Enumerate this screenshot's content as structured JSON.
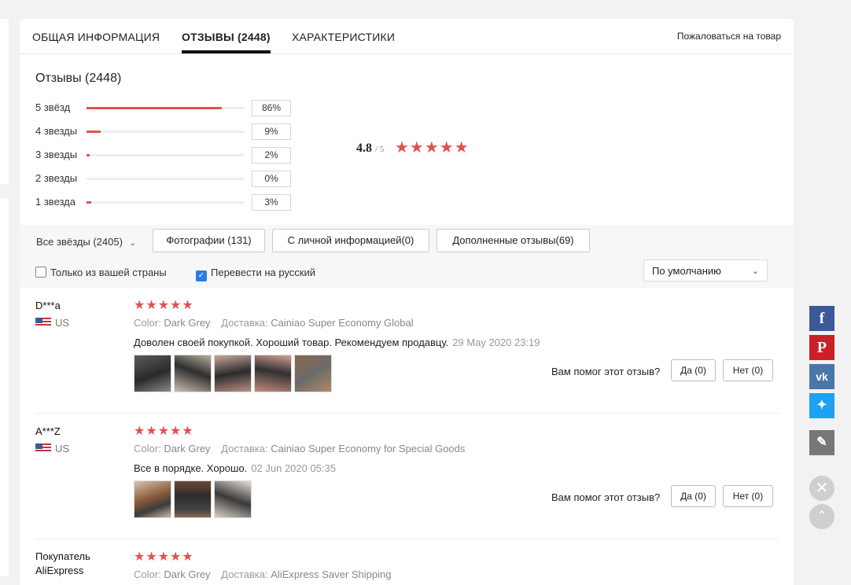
{
  "tabs": {
    "general": "ОБЩАЯ ИНФОРМАЦИЯ",
    "reviews": "ОТЗЫВЫ (2448)",
    "specs": "ХАРАКТЕРИСТИКИ",
    "report": "Пожаловаться на товар"
  },
  "summary": {
    "title": "Отзывы (2448)",
    "rows": [
      {
        "label": "5 звёзд",
        "percent": "86%",
        "fraction": 0.86
      },
      {
        "label": "4 звезды",
        "percent": "9%",
        "fraction": 0.09
      },
      {
        "label": "3 звезды",
        "percent": "2%",
        "fraction": 0.02
      },
      {
        "label": "2 звезды",
        "percent": "0%",
        "fraction": 0.0
      },
      {
        "label": "1 звезда",
        "percent": "3%",
        "fraction": 0.03
      }
    ],
    "average": "4.8",
    "max": "/ 5",
    "stars": "★★★★★"
  },
  "filters": {
    "all_stars": "Все звёзды (2405)",
    "photos": "Фотографии (131)",
    "personal_info": "С личной информацией(0)",
    "additional": "Дополненные отзывы(69)",
    "only_country": "Только из вашей страны",
    "translate": "Перевести на русский",
    "sort": "По умолчанию"
  },
  "reviews": [
    {
      "name": "D***a",
      "country": "US",
      "stars": "★★★★★",
      "color_label": "Color:",
      "color": "Dark Grey",
      "shipping_label": "Доставка:",
      "shipping": "Cainiao Super Economy Global",
      "text": "Доволен своей покупкой. Хороший товар. Рекомендуем продавцу.",
      "date": "29 May 2020 23:19",
      "photo_count": 5,
      "helpful": "Вам помог этот отзыв?",
      "yes": "Да (0)",
      "no": "Нет (0)"
    },
    {
      "name": "A***Z",
      "country": "US",
      "stars": "★★★★★",
      "color_label": "Color:",
      "color": "Dark Grey",
      "shipping_label": "Доставка:",
      "shipping": "Cainiao Super Economy for Special Goods",
      "text": "Все в порядке. Хорошо.",
      "date": "02 Jun 2020 05:35",
      "photo_count": 3,
      "helpful": "Вам помог этот отзыв?",
      "yes": "Да (0)",
      "no": "Нет (0)"
    },
    {
      "name": "Покупатель AliExpress",
      "stars": "★★★★★",
      "color_label": "Color:",
      "color": "Dark Grey",
      "shipping_label": "Доставка:",
      "shipping": "AliExpress Saver Shipping"
    }
  ],
  "side_icons": [
    "facebook-icon",
    "pinterest-icon",
    "vk-icon",
    "twitter-icon",
    "edit-icon",
    "close-icon",
    "scroll-up-icon"
  ],
  "colors": {
    "accent": "#e0524f",
    "checkbox": "#2c7be5",
    "facebook": "#3b5998",
    "pinterest": "#cb2027",
    "vk": "#4a76a8",
    "twitter": "#1da1f2"
  }
}
